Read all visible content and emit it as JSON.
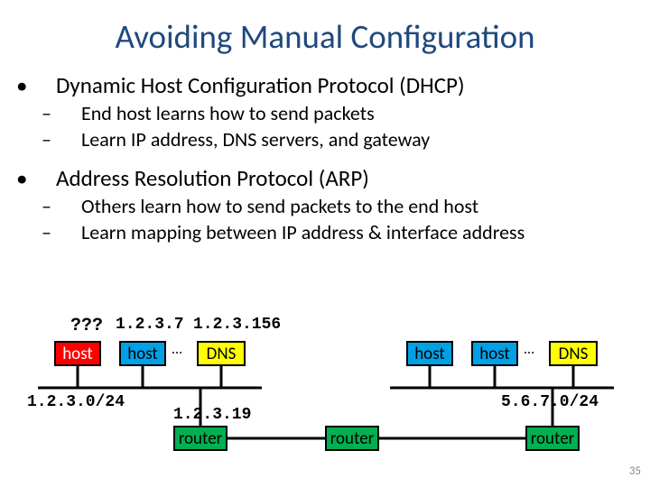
{
  "title": "Avoiding Manual Configuration",
  "bullets": {
    "b1": "Dynamic Host Configuration Protocol (DHCP)",
    "b1a": "End host learns how to send packets",
    "b1b": "Learn IP address, DNS servers, and gateway",
    "b2": "Address Resolution Protocol (ARP)",
    "b2a": "Others learn how to send packets to the end host",
    "b2b": "Learn mapping between IP address & interface address"
  },
  "diagram": {
    "q": "???",
    "ip1": "1.2.3.7",
    "ip2": "1.2.3.156",
    "host": "host",
    "dns": "DNS",
    "router": "router",
    "dots": "...",
    "net_left": "1.2.3.0/24",
    "gateway": "1.2.3.19",
    "net_right": "5.6.7.0/24"
  },
  "pagenum": "35"
}
